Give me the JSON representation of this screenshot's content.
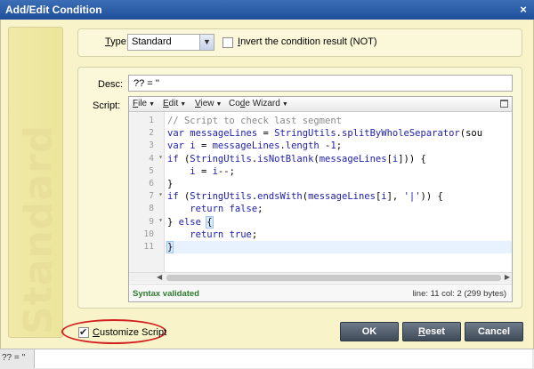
{
  "window": {
    "title": "Add/Edit Condition",
    "close_glyph": "×"
  },
  "sidebar": {
    "watermark": "Standard"
  },
  "type_row": {
    "type_label_prefix": "T",
    "type_label_rest": "ype:",
    "selected": "Standard",
    "invert_label_prefix": "I",
    "invert_label_rest": "nvert the condition result (NOT)",
    "invert_checked": false
  },
  "desc": {
    "label": "Desc:",
    "value": "??  = ''"
  },
  "script": {
    "label": "Script:",
    "menu": [
      {
        "prefix": "F",
        "rest": "ile"
      },
      {
        "prefix": "E",
        "rest": "dit"
      },
      {
        "prefix": "V",
        "rest": "iew"
      },
      {
        "prefix": "Co",
        "u": "d",
        "rest": "e Wizard"
      }
    ],
    "line_numbers": [
      "1",
      "2",
      "3",
      "4",
      "5",
      "6",
      "7",
      "8",
      "9",
      "10",
      "11"
    ],
    "fold_markers": [
      "",
      "",
      "",
      "▾",
      "",
      "",
      "▾",
      "",
      "▾",
      "",
      ""
    ],
    "active_line": 11,
    "lines": [
      [
        [
          "c-cm",
          "// Script to check last segment"
        ]
      ],
      [
        [
          "c-kw",
          "var "
        ],
        [
          "c-id",
          "messageLines"
        ],
        [
          "c-pl",
          " = "
        ],
        [
          "c-id",
          "StringUtils"
        ],
        [
          "c-pl",
          "."
        ],
        [
          "c-fn",
          "splitByWholeSeparator"
        ],
        [
          "c-pl",
          "(sou"
        ]
      ],
      [
        [
          "c-kw",
          "var "
        ],
        [
          "c-id",
          "i"
        ],
        [
          "c-pl",
          " = "
        ],
        [
          "c-id",
          "messageLines"
        ],
        [
          "c-pl",
          "."
        ],
        [
          "c-id",
          "length"
        ],
        [
          "c-pl",
          " -"
        ],
        [
          "c-num",
          "1"
        ],
        [
          "c-pl",
          ";"
        ]
      ],
      [
        [
          "c-kw",
          "if "
        ],
        [
          "c-pl",
          "("
        ],
        [
          "c-id",
          "StringUtils"
        ],
        [
          "c-pl",
          "."
        ],
        [
          "c-fn",
          "isNotBlank"
        ],
        [
          "c-pl",
          "("
        ],
        [
          "c-id",
          "messageLines"
        ],
        [
          "c-pl",
          "["
        ],
        [
          "c-id",
          "i"
        ],
        [
          "c-pl",
          "])) {"
        ]
      ],
      [
        [
          "c-pl",
          "    "
        ],
        [
          "c-id",
          "i"
        ],
        [
          "c-pl",
          " = "
        ],
        [
          "c-id",
          "i"
        ],
        [
          "c-pl",
          "--;"
        ]
      ],
      [
        [
          "c-pl",
          "}"
        ]
      ],
      [
        [
          "c-kw",
          "if "
        ],
        [
          "c-pl",
          "("
        ],
        [
          "c-id",
          "StringUtils"
        ],
        [
          "c-pl",
          "."
        ],
        [
          "c-fn",
          "endsWith"
        ],
        [
          "c-pl",
          "("
        ],
        [
          "c-id",
          "messageLines"
        ],
        [
          "c-pl",
          "["
        ],
        [
          "c-id",
          "i"
        ],
        [
          "c-pl",
          "], "
        ],
        [
          "c-str",
          "'|'"
        ],
        [
          "c-pl",
          ")) {"
        ]
      ],
      [
        [
          "c-pl",
          "    "
        ],
        [
          "c-kw",
          "return "
        ],
        [
          "c-kw",
          "false"
        ],
        [
          "c-pl",
          ";"
        ]
      ],
      [
        [
          "c-pl",
          "} "
        ],
        [
          "c-kw",
          "else "
        ],
        [
          "c-brh",
          "{"
        ]
      ],
      [
        [
          "c-pl",
          "    "
        ],
        [
          "c-kw",
          "return "
        ],
        [
          "c-kw",
          "true"
        ],
        [
          "c-pl",
          ";"
        ]
      ],
      [
        [
          "c-brh",
          "}"
        ]
      ]
    ],
    "status_left": "Syntax validated",
    "status_right": "line: 11  col: 2  (299 bytes)"
  },
  "customize": {
    "checked": true,
    "label_prefix": "C",
    "label_rest": "ustomize Script"
  },
  "buttons": {
    "ok": "OK",
    "reset_prefix": "R",
    "reset_rest": "eset",
    "cancel": "Cancel"
  },
  "bottom_bar": {
    "text": "?? = ''"
  }
}
